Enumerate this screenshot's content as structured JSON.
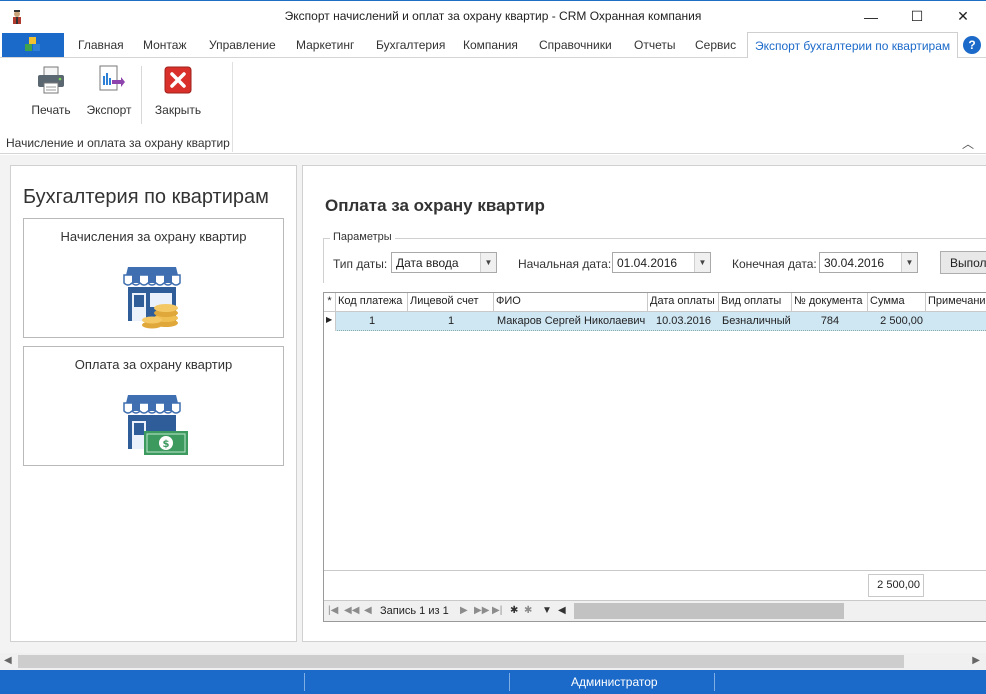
{
  "window": {
    "title": "Экспорт начислений и оплат за охрану квартир - CRM Охранная компания",
    "minimize_glyph": "—",
    "maximize_glyph": "☐",
    "close_glyph": "✕"
  },
  "ribbon_tabs": [
    {
      "label": "Главная"
    },
    {
      "label": "Монтаж"
    },
    {
      "label": "Управление"
    },
    {
      "label": "Маркетинг"
    },
    {
      "label": "Бухгалтерия"
    },
    {
      "label": "Компания"
    },
    {
      "label": "Справочники"
    },
    {
      "label": "Отчеты"
    },
    {
      "label": "Сервис"
    },
    {
      "label": "Экспорт бухгалтерии по квартирам",
      "active": true
    }
  ],
  "help_glyph": "?",
  "ribbon": {
    "buttons": {
      "print": "Печать",
      "export": "Экспорт",
      "close": "Закрыть"
    },
    "group_label": "Начисление и оплата за охрану квартир",
    "collapse_glyph": "︿"
  },
  "left_panel": {
    "title": "Бухгалтерия по квартирам",
    "tiles": [
      {
        "label": "Начисления за охрану квартир",
        "icon": "shop-coins-icon"
      },
      {
        "label": "Оплата за охрану квартир",
        "icon": "shop-cash-icon"
      }
    ]
  },
  "main_panel": {
    "title": "Оплата за охрану квартир",
    "params": {
      "legend": "Параметры",
      "date_type_label": "Тип даты:",
      "date_type_value": "Дата ввода",
      "start_label": "Начальная дата:",
      "start_value": "01.04.2016",
      "end_label": "Конечная дата:",
      "end_value": "30.04.2016",
      "run_label": "Выполнить"
    },
    "grid": {
      "columns": [
        "Код платежа",
        "Лицевой счет",
        "ФИО",
        "Дата оплаты",
        "Вид оплаты",
        "№ документа",
        "Сумма",
        "Примечание"
      ],
      "rows": [
        [
          "1",
          "1",
          "Макаров Сергей Николаевич",
          "10.03.2016",
          "Безналичный",
          "784",
          "2 500,00",
          ""
        ]
      ],
      "total": "2 500,00",
      "record_text": "Запись 1 из 1"
    }
  },
  "statusbar": {
    "user": "Администратор"
  },
  "colors": {
    "accent": "#1b6ac9",
    "selected_row": "#cfe6f3"
  }
}
